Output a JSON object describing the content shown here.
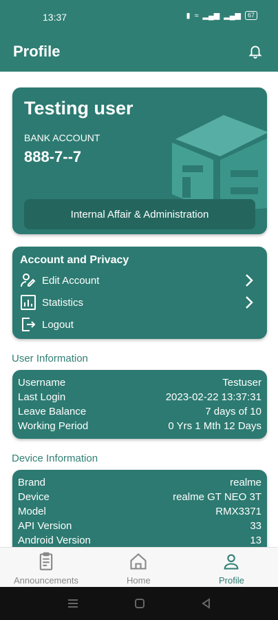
{
  "status_bar": {
    "time": "13:37",
    "battery": "67"
  },
  "header": {
    "title": "Profile"
  },
  "profile_card": {
    "name": "Testing user",
    "bank_label": "BANK ACCOUNT",
    "bank_number": "888-7--7",
    "department": "Internal Affair & Administration"
  },
  "account_privacy": {
    "title": "Account and Privacy",
    "items": [
      {
        "label": "Edit Account",
        "icon": "edit-user-icon",
        "chevron": true
      },
      {
        "label": "Statistics",
        "icon": "bar-chart-icon",
        "chevron": true
      },
      {
        "label": "Logout",
        "icon": "logout-icon",
        "chevron": false
      }
    ]
  },
  "user_information": {
    "title": "User Information",
    "rows": [
      {
        "label": "Username",
        "value": "Testuser"
      },
      {
        "label": "Last Login",
        "value": "2023-02-22 13:37:31"
      },
      {
        "label": "Leave Balance",
        "value": "7 days of 10"
      },
      {
        "label": "Working Period",
        "value": "0 Yrs 1 Mth 12 Days"
      }
    ]
  },
  "device_information": {
    "title": "Device Information",
    "rows": [
      {
        "label": "Brand",
        "value": "realme"
      },
      {
        "label": "Device",
        "value": "realme GT NEO 3T"
      },
      {
        "label": "Model",
        "value": "RMX3371"
      },
      {
        "label": "API Version",
        "value": "33"
      },
      {
        "label": "Android Version",
        "value": "13"
      }
    ]
  },
  "bottom_nav": {
    "items": [
      {
        "label": "Announcements",
        "icon": "clipboard-icon",
        "active": false
      },
      {
        "label": "Home",
        "icon": "home-icon",
        "active": false
      },
      {
        "label": "Profile",
        "icon": "person-icon",
        "active": true
      }
    ]
  },
  "colors": {
    "primary": "#2f7f74",
    "card": "#2c7a71",
    "card_dark": "#24665e"
  }
}
